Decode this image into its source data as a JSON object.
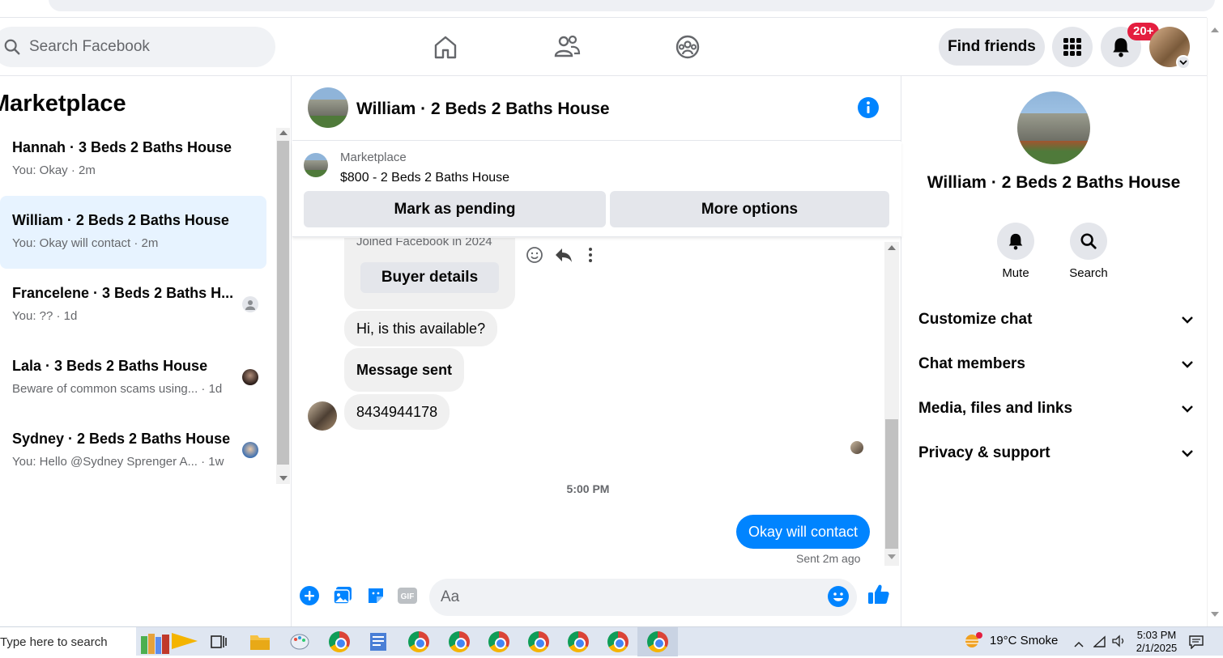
{
  "topnav": {
    "search_placeholder": "Search Facebook",
    "find_friends": "Find friends",
    "notification_badge": "20+"
  },
  "left": {
    "title": "Marketplace",
    "conversations": [
      {
        "name": "Hannah · 3 Beds 2 Baths House",
        "sub": "You: Okay · 2m",
        "active": false
      },
      {
        "name": "William · 2 Beds 2 Baths House",
        "sub": "You: Okay will contact · 2m",
        "active": true
      },
      {
        "name": "Francelene · 3 Beds 2 Baths H...",
        "sub": "You: ?? · 1d",
        "active": false
      },
      {
        "name": "Lala · 3 Beds 2 Baths House",
        "sub": "Beware of common scams using... · 1d",
        "active": false
      },
      {
        "name": "Sydney · 2 Beds 2 Baths House",
        "sub": "You: Hello @Sydney Sprenger A... · 1w",
        "active": false
      }
    ]
  },
  "chat": {
    "title": "William · 2 Beds 2 Baths House",
    "listing": {
      "label": "Marketplace",
      "price_title": "$800 - 2 Beds 2 Baths House",
      "mark_pending": "Mark as pending",
      "more_options": "More options"
    },
    "joined_text": "Joined Facebook in 2024",
    "buyer_details": "Buyer details",
    "messages": [
      {
        "text": "Hi, is this available?",
        "bold": false
      },
      {
        "text": "Message sent",
        "bold": true
      },
      {
        "text": "8434944178",
        "bold": false
      }
    ],
    "time_divider": "5:00 PM",
    "sent_message": "Okay will contact",
    "sent_status": "Sent 2m ago",
    "composer_placeholder": "Aa"
  },
  "right": {
    "title": "William · 2 Beds 2 Baths House",
    "mute": "Mute",
    "search": "Search",
    "sections": [
      "Customize chat",
      "Chat members",
      "Media, files and links",
      "Privacy & support"
    ]
  },
  "taskbar": {
    "search_text": "Type here to search",
    "weather": "19°C  Smoke",
    "time": "5:03 PM",
    "date": "2/1/2025"
  },
  "colors": {
    "accent": "#0084ff",
    "badge": "#e41e3f",
    "active_conv": "#e7f3ff"
  }
}
